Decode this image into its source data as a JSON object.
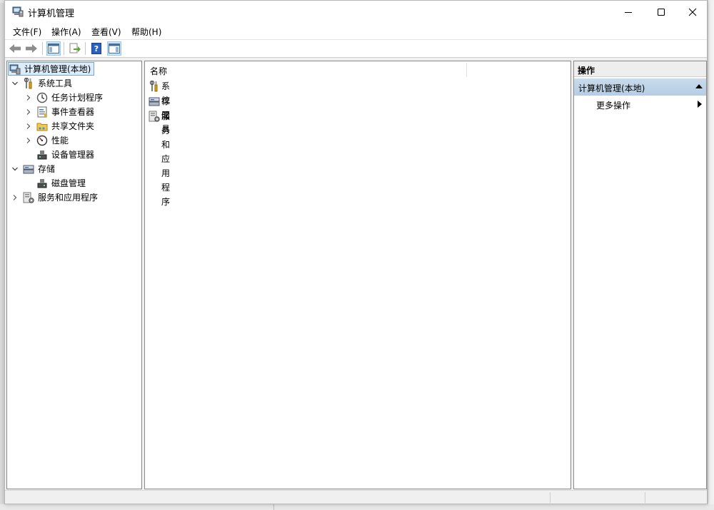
{
  "window": {
    "title": "计算机管理",
    "controls": {
      "minimize": "minimize-icon",
      "maximize": "maximize-icon",
      "close": "close-icon"
    }
  },
  "menubar": {
    "items": [
      "文件(F)",
      "操作(A)",
      "查看(V)",
      "帮助(H)"
    ]
  },
  "toolbar": {
    "buttons": [
      "back-arrow-icon",
      "forward-arrow-icon",
      "show-hide-console-tree-icon",
      "export-list-icon",
      "help-icon",
      "show-hide-action-pane-icon"
    ]
  },
  "tree": {
    "root": "计算机管理(本地)",
    "system_tools": "系统工具",
    "task_scheduler": "任务计划程序",
    "event_viewer": "事件查看器",
    "shared_folders": "共享文件夹",
    "performance": "性能",
    "device_manager": "设备管理器",
    "storage": "存储",
    "disk_management": "磁盘管理",
    "services_apps": "服务和应用程序"
  },
  "list": {
    "column_name": "名称",
    "items": [
      "系统工具",
      "存储",
      "服务和应用程序"
    ]
  },
  "actions": {
    "header": "操作",
    "section": "计算机管理(本地)",
    "more": "更多操作"
  },
  "colors": {
    "selection_bg": "#ddecfb",
    "selection_border": "#6ea7d8",
    "action_section_bg": "#c2d6ea"
  }
}
